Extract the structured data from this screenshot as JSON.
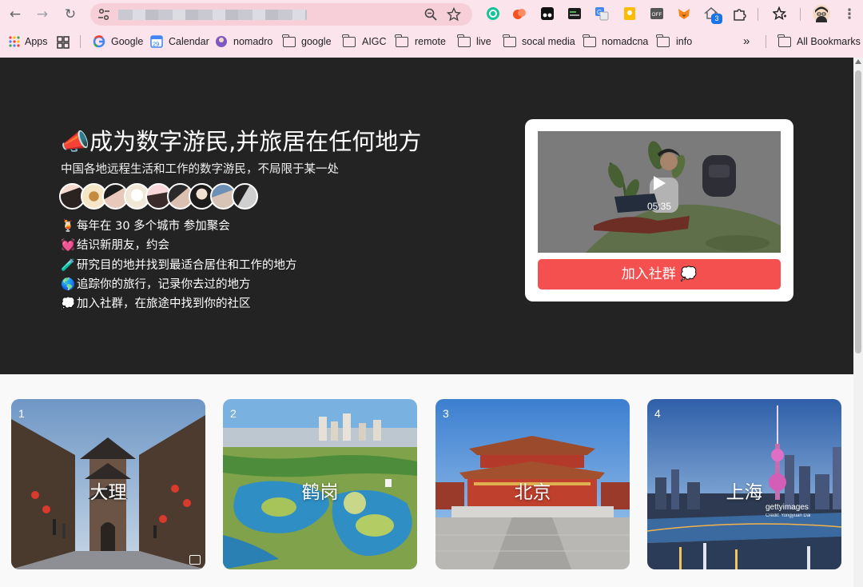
{
  "browser": {
    "bookmarks": [
      "Apps",
      "Google",
      "Calendar",
      "nomadro",
      "google",
      "AIGC",
      "remote",
      "live",
      "socal media",
      "nomadcna",
      "info"
    ],
    "all_bookmarks": "All Bookmarks",
    "calendar_day": "29",
    "extension_badge": "3",
    "ext_off_label": "OFF"
  },
  "hero": {
    "title_icon": "📣",
    "title": "成为数字游民,并旅居在任何地方",
    "subtitle": "中国各地远程生活和工作的数字游民，不局限于某一处",
    "features": [
      {
        "icon": "🍹",
        "text": "每年在 30 多个城市 参加聚会"
      },
      {
        "icon": "💓",
        "text": "结识新朋友，约会"
      },
      {
        "icon": "🧪",
        "text": "研究目的地并找到最适合居住和工作的地方"
      },
      {
        "icon": "🌎",
        "text": "追踪你的旅行，记录你去过的地方"
      },
      {
        "icon": "💭",
        "text": "加入社群，在旅途中找到你的社区"
      }
    ]
  },
  "video": {
    "duration": "05:35",
    "join_label": "加入社群 💭"
  },
  "cities": [
    {
      "rank": "1",
      "name": "大理"
    },
    {
      "rank": "2",
      "name": "鹤岗"
    },
    {
      "rank": "3",
      "name": "北京"
    },
    {
      "rank": "4",
      "name": "上海",
      "watermark": "gettyimages",
      "credit": "Credit: Yongyuan Dai"
    }
  ],
  "colors": {
    "chrome_bg": "#fce4ec",
    "hero_bg": "#232323",
    "join_button": "#f45050"
  }
}
